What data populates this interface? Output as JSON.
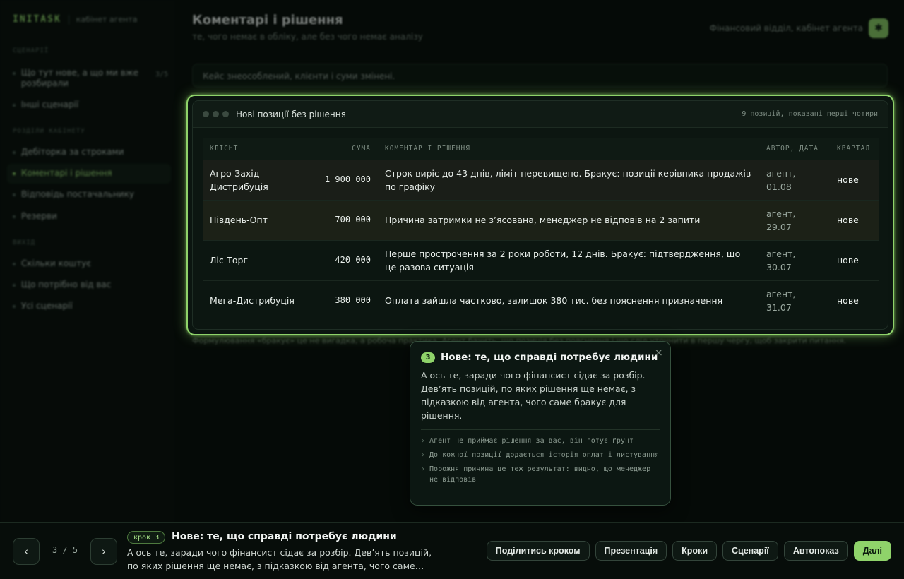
{
  "brand": {
    "logo": "INITASK",
    "subtitle": "кабінет агента"
  },
  "sidebar": {
    "sections": [
      {
        "title": "СЦЕНАРІЇ",
        "items": [
          {
            "label": "Що тут нове, а що ми вже розбирали",
            "count": "3/5"
          },
          {
            "label": "Інші сценарії"
          }
        ]
      },
      {
        "title": "РОЗДІЛИ КАБІНЕТУ",
        "items": [
          {
            "label": "Дебіторка за строками"
          },
          {
            "label": "Коментарі і рішення",
            "active": true
          },
          {
            "label": "Відповідь постачальнику"
          },
          {
            "label": "Резерви"
          }
        ]
      },
      {
        "title": "ВИХІД",
        "items": [
          {
            "label": "Скільки коштує"
          },
          {
            "label": "Що потрібно від вас"
          },
          {
            "label": "Усі сценарії"
          }
        ]
      }
    ]
  },
  "header": {
    "title": "Коментарі і рішення",
    "subtitle": "те, чого немає в обліку, але без чого немає аналізу",
    "department": "Фінансовий відділ, кабінет агента",
    "icon": "agent-icon"
  },
  "notice": "Кейс знеособлений, клієнти і суми змінені.",
  "footnote": "Формулювання «бракує» це не вигадка, а робоча практика. Агент бачить, що позиція без пояснення і що слід уточнити в першу чергу, щоб закрити питання.",
  "card": {
    "title": "Нові позиції без рішення",
    "meta": "9 позицій, показані перші чотири",
    "columns": [
      "КЛІЄНТ",
      "СУМА",
      "КОМЕНТАР І РІШЕННЯ",
      "АВТОР, ДАТА",
      "КВАРТАЛ"
    ],
    "rows": [
      {
        "client": "Агро-Захід Дистрибуція",
        "amount": "1 900 000",
        "comment": "Строк виріс до 43 днів, ліміт перевищено. Бракує: позиції керівника продажів по графіку",
        "author": "агент, 01.08",
        "quarter": "нове"
      },
      {
        "client": "Південь-Опт",
        "amount": "700 000",
        "comment": "Причина затримки не з’ясована, менеджер не відповів на 2 запити",
        "author": "агент, 29.07",
        "quarter": "нове"
      },
      {
        "client": "Ліс-Торг",
        "amount": "420 000",
        "comment": "Перше прострочення за 2 роки роботи, 12 днів. Бракує: підтвердження, що це разова ситуація",
        "author": "агент, 30.07",
        "quarter": "нове"
      },
      {
        "client": "Мега-Дистрибуція",
        "amount": "380 000",
        "comment": "Оплата зайшла частково, залишок 380 тис. без пояснення призначення",
        "author": "агент, 31.07",
        "quarter": "нове"
      }
    ]
  },
  "tooltip": {
    "number": "3",
    "title": "Нове: те, що справді потребує людини",
    "body": "А ось те, заради чого фінансист сідає за розбір. Дев’ять позицій, по яких рішення ще немає, з підказкою від агента, чого саме бракує для рішення.",
    "bullets": [
      "Агент не приймає рішення за вас, він готує ґрунт",
      "До кожної позиції додається історія оплат і листування",
      "Порожня причина це теж результат: видно, що менеджер не відповів"
    ],
    "close": "×"
  },
  "footer": {
    "prev": "‹",
    "next": "›",
    "counter": "3 / 5",
    "step_badge": "крок 3",
    "step_title": "Нове: те, що справді потребує людини",
    "step_desc": "А ось те, заради чого фінансист сідає за розбір. Дев’ять позицій, по яких рішення ще немає, з підказкою від агента, чого саме…",
    "actions": [
      "Поділитись кроком",
      "Презентація",
      "Кроки",
      "Сценарії",
      "Автопоказ",
      "Далі"
    ]
  },
  "colors": {
    "accent": "#8fd36a",
    "background": "#050a07"
  }
}
